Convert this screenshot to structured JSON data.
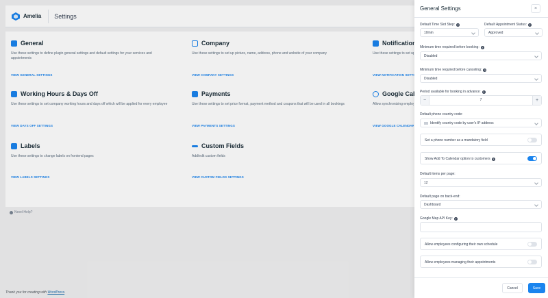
{
  "header": {
    "brand": "Amelia",
    "title": "Settings"
  },
  "cards": [
    {
      "title": "General",
      "desc": "Use these settings to define plugin general settings and default settings for your services and appointments",
      "link": "VIEW GENERAL SETTINGS"
    },
    {
      "title": "Company",
      "desc": "Use these settings to set up picture, name, address, phone and website of your company",
      "link": "VIEW COMPANY SETTINGS"
    },
    {
      "title": "Notification",
      "desc": "Use these settings to set up",
      "link": "VIEW NOTIFICATION SETTINGS"
    },
    {
      "title": "Working Hours & Days Off",
      "desc": "Use these settings to set company working hours and days off which will be applied for every employee",
      "link": "VIEW DAYS OFF SETTINGS"
    },
    {
      "title": "Payments",
      "desc": "Use these settings to set price format, payment method and coupons that will be used in all bookings",
      "link": "VIEW PAYMENTS SETTINGS"
    },
    {
      "title": "Google Calendar",
      "desc": "Allow synchronizing employees",
      "link": "VIEW GOOGLE CALENDAR SETTINGS"
    },
    {
      "title": "Labels",
      "desc": "Use these settings to change labels on frontend pages",
      "link": "VIEW LABELS SETTINGS"
    },
    {
      "title": "Custom Fields",
      "desc": "Add/edit custom fields",
      "link": "VIEW CUSTOM FIELDS SETTINGS"
    }
  ],
  "help": "Need Help?",
  "footer": {
    "prefix": "Thank you for creating with ",
    "link": "WordPress",
    "suffix": "."
  },
  "drawer": {
    "title": "General Settings",
    "close": "×",
    "time_slot_label": "Default Time Slot Step:",
    "time_slot_value": "10min",
    "appt_status_label": "Default Appointment Status:",
    "appt_status_value": "Approved",
    "min_booking_label": "Minimum time required before booking:",
    "min_booking_value": "Disabled",
    "min_cancel_label": "Minimum time required before canceling:",
    "min_cancel_value": "Disabled",
    "period_label": "Period available for booking in advance:",
    "period_minus": "−",
    "period_value": "7",
    "period_plus": "+",
    "country_label": "Default phone country code:",
    "country_value": "Identify country code by user's IP address",
    "phone_mandatory": "Set a phone number as a mandatory field",
    "add_calendar": "Show Add To Calendar option to customers",
    "items_label": "Default items per page:",
    "items_value": "12",
    "backend_label": "Default page on back-end:",
    "backend_value": "Dashboard",
    "map_key_label": "Google Map API Key:",
    "emp_schedule": "Allow employees configuring their own schedule",
    "emp_appointments": "Allow employees managing their appointments",
    "cancel": "Cancel",
    "save": "Save"
  },
  "colors": {
    "accent": "#1a84ee",
    "text": "#354052"
  },
  "toggles": {
    "phone_mandatory": false,
    "add_calendar": true,
    "emp_schedule": false,
    "emp_appointments": false
  }
}
